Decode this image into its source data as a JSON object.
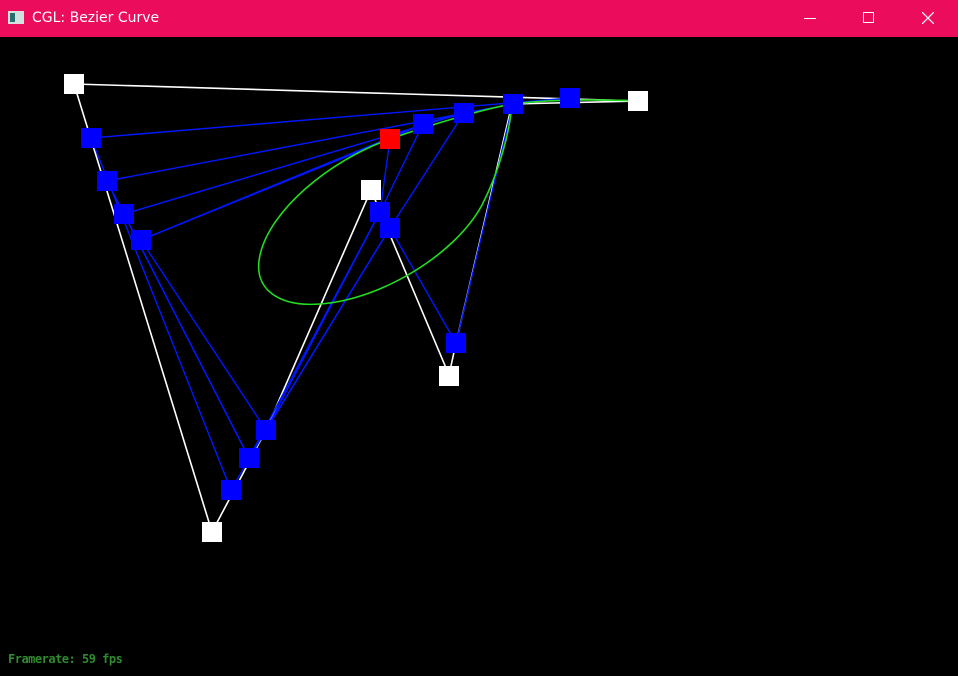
{
  "window": {
    "title": "CGL: Bezier Curve",
    "titlebar_color": "#ec0c5c",
    "buttons": [
      "minimize-icon",
      "maximize-icon",
      "close-icon"
    ]
  },
  "scene": {
    "background": "#000000",
    "colors": {
      "control_polygon": "#ffffff",
      "construction_lines": "#0000ff",
      "curve": "#22dd22",
      "current_point": "#ff0000"
    }
  },
  "status": {
    "framerate": "Framerate: 59 fps"
  }
}
